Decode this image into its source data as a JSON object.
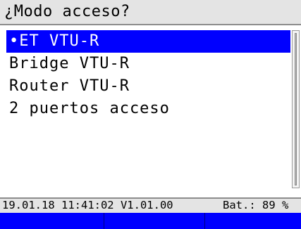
{
  "header": {
    "title": "¿Modo acceso?"
  },
  "menu": {
    "items": [
      {
        "label": "•ET VTU-R",
        "selected": true
      },
      {
        "label": "Bridge VTU-R",
        "selected": false
      },
      {
        "label": "Router VTU-R",
        "selected": false
      },
      {
        "label": "2 puertos acceso",
        "selected": false
      }
    ]
  },
  "status": {
    "info": "19.01.18 11:41:02 V1.01.00",
    "battery": "Bat.:  89 %"
  },
  "softkeys": [
    "",
    "",
    ""
  ],
  "colors": {
    "highlight": "#0000ff",
    "softkey_bar": "#0000ff",
    "title_bar": "#e4e4e4"
  }
}
